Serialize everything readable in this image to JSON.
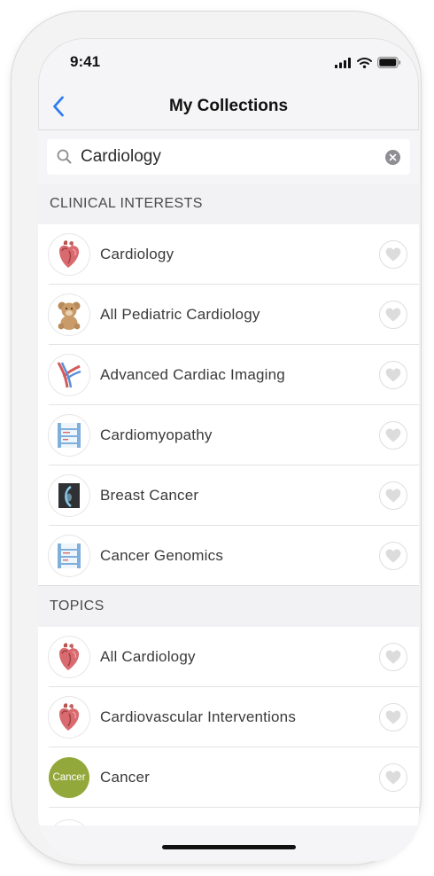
{
  "status_bar": {
    "time": "9:41",
    "icons": [
      "signal-icon",
      "wifi-icon",
      "battery-icon"
    ]
  },
  "nav": {
    "title": "My Collections",
    "back_icon": "chevron-left-icon"
  },
  "search": {
    "value": "Cardiology",
    "placeholder": ""
  },
  "sections": {
    "clinical": {
      "header": "CLINICAL INTERESTS",
      "items": [
        {
          "label": "Cardiology",
          "icon": "heart-icon"
        },
        {
          "label": "All Pediatric Cardiology",
          "icon": "teddy-bear-icon"
        },
        {
          "label": "Advanced Cardiac Imaging",
          "icon": "blood-vessel-icon"
        },
        {
          "label": "Cardiomyopathy",
          "icon": "ladder-chart-icon"
        },
        {
          "label": "Breast Cancer",
          "icon": "mammogram-icon"
        },
        {
          "label": "Cancer Genomics",
          "icon": "ladder-chart-icon"
        }
      ]
    },
    "topics": {
      "header": "TOPICS",
      "items": [
        {
          "label": "All Cardiology",
          "icon": "heart-icon"
        },
        {
          "label": "Cardiovascular Interventions",
          "icon": "heart-icon"
        },
        {
          "label": "Cancer",
          "icon": "cancer-badge-icon",
          "badge_text": "Cancer"
        }
      ]
    }
  },
  "colors": {
    "accent": "#2e7cf6",
    "background": "#f5f5f7",
    "cancer_badge": "#93a83a",
    "heart": "#d96a6f"
  }
}
